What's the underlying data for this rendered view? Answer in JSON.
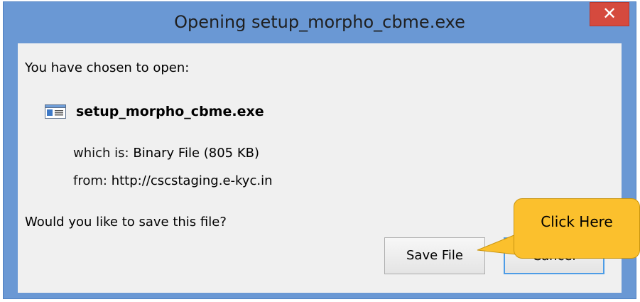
{
  "dialog": {
    "title": "Opening setup_morpho_cbme.exe",
    "close_glyph": "✕",
    "intro": "You have chosen to open:",
    "file": {
      "name": "setup_morpho_cbme.exe",
      "icon": "executable-file-icon",
      "which_is_label": "which is:",
      "which_is_value": "Binary File (805 KB)",
      "from_label": "from:",
      "from_value": "http://cscstaging.e-kyc.in"
    },
    "question": "Would you like to save this file?",
    "buttons": {
      "save": "Save File",
      "cancel": "Cancel"
    }
  },
  "annotation": {
    "callout_text": "Click Here",
    "color": "#fbc02d"
  },
  "colors": {
    "frame": "#6a98d4",
    "close": "#d54a3e",
    "client": "#f0f0f0"
  }
}
